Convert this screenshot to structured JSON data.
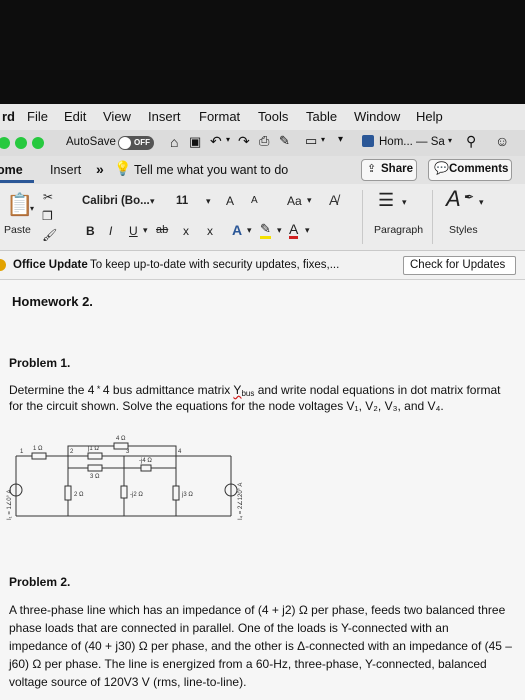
{
  "menu": {
    "app_fragment": "rd",
    "items": [
      "File",
      "Edit",
      "View",
      "Insert",
      "Format",
      "Tools",
      "Table",
      "Window",
      "Help"
    ]
  },
  "toolbar": {
    "autosave_label": "AutoSave",
    "autosave_state": "OFF",
    "doc_title": "Hom... — Sa"
  },
  "tabs": {
    "home": "Home",
    "insert": "Insert",
    "more": "»",
    "tellme": "Tell me what you want to do",
    "share": "Share",
    "comments": "Comments"
  },
  "ribbon": {
    "paste": "Paste",
    "font_name": "Calibri (Bo...",
    "font_size": "11",
    "grow": "A",
    "shrink": "A",
    "case": "Aa",
    "bold": "B",
    "italic": "I",
    "underline": "U",
    "strike": "ab",
    "subscript": "x",
    "superscript": "x",
    "highlight": "A",
    "paragraph": "Paragraph",
    "styles": "Styles"
  },
  "update": {
    "title": "Office Update",
    "message": "To keep up-to-date with security updates, fixes,...",
    "button": "Check for Updates"
  },
  "doc": {
    "heading": "Homework 2.",
    "p1_title": "Problem 1.",
    "p1_line1_a": "Determine the 4",
    "p1_line1_b": "4 bus admittance matrix",
    "p1_ybus": "Y",
    "p1_ybus_sub": "bus",
    "p1_line1_c": "and write nodal equations in dot matrix format",
    "p1_line2": "for the circuit shown.  Solve the equations for the node voltages V₁, V₂, V₃, and V₄.",
    "p2_title": "Problem 2.",
    "p2_l1": "A three-phase line which has an impedance of (4 + j2) Ω per phase, feeds two balanced three",
    "p2_l2": "phase loads that are connected in parallel.  One of the loads is Y-connected with an",
    "p2_l3": "impedance of (40 + j30) Ω per phase, and the other is Δ-connected with an impedance of (45 –",
    "p2_l4": "j60) Ω per phase.  The line is energized from a 60-Hz, three-phase, Y-connected, balanced",
    "p2_l5": "voltage source of 120V3 V (rms, line-to-line)."
  },
  "circuit": {
    "r14": "1 Ω",
    "r23": "j1 Ω",
    "r_top": "4 Ω",
    "r_mid": "3 Ω",
    "r_j4": "-j4 Ω",
    "r_2": "2 Ω",
    "r_j2": "-j2 Ω",
    "r_j3": "j3 Ω",
    "src_left": "I₁ = 1∠0° A",
    "src_right": "I₄ = 2∠120° A",
    "n1": "1",
    "n2": "2",
    "n3": "3",
    "n4": "4"
  }
}
